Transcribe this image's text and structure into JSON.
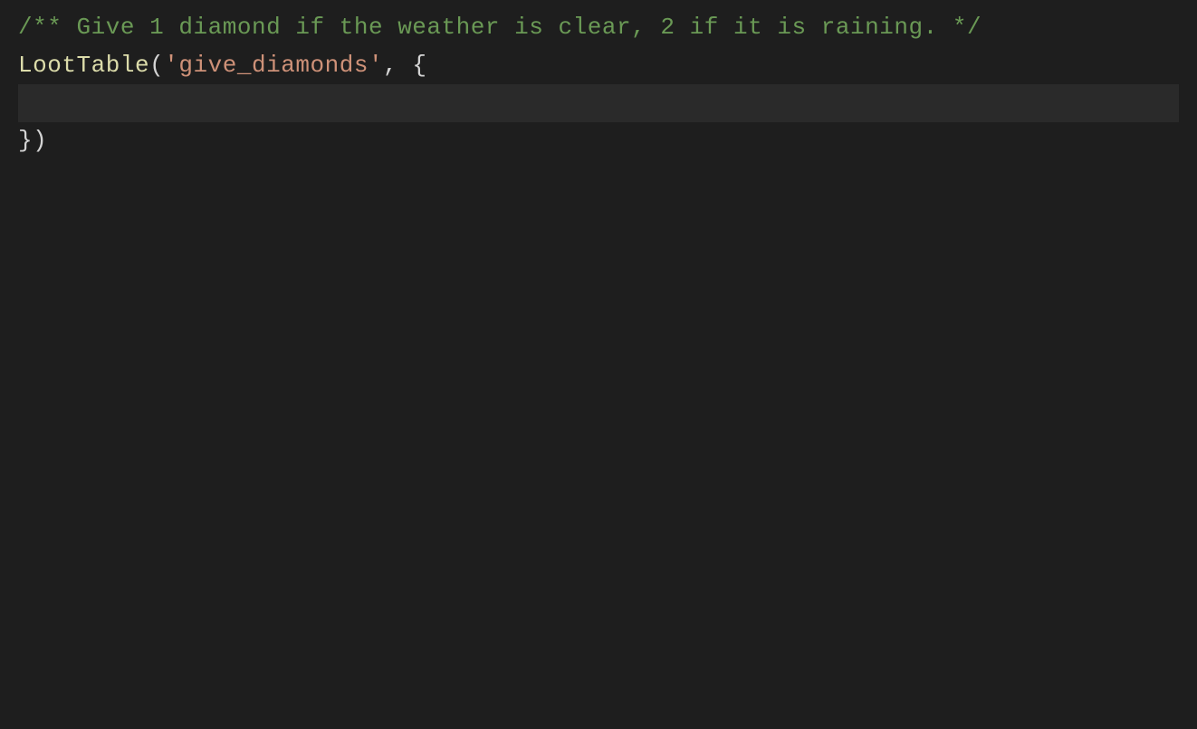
{
  "editor": {
    "background": "#1e1e1e",
    "lines": [
      {
        "id": "line1",
        "type": "comment",
        "content": "/** Give 1 diamond if the weather is clear, 2 if it is raining. */"
      },
      {
        "id": "line2",
        "type": "code",
        "parts": [
          {
            "text": "LootTable",
            "color": "function"
          },
          {
            "text": "(",
            "color": "punctuation"
          },
          {
            "text": "'give_diamonds'",
            "color": "string"
          },
          {
            "text": ", {",
            "color": "punctuation"
          }
        ]
      },
      {
        "id": "line3",
        "type": "empty",
        "highlight": true
      },
      {
        "id": "line4",
        "type": "code",
        "parts": [
          {
            "text": "})",
            "color": "punctuation"
          }
        ]
      }
    ]
  }
}
